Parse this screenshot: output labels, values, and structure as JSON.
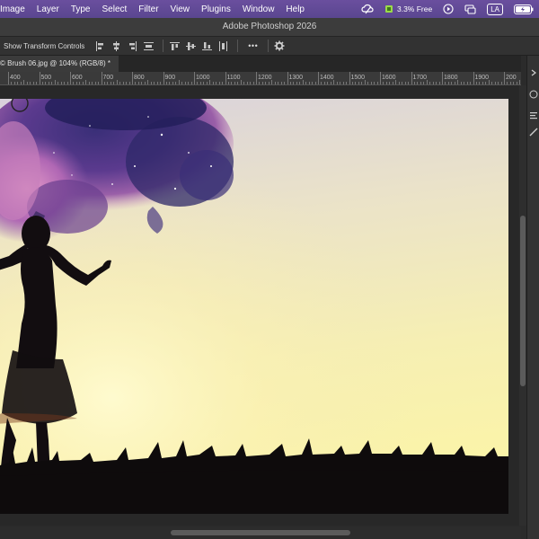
{
  "menubar": {
    "items": [
      "Image",
      "Layer",
      "Type",
      "Select",
      "Filter",
      "View",
      "Plugins",
      "Window",
      "Help"
    ],
    "status": {
      "cpu_label": "3.3% Free",
      "user_badge": "LA"
    }
  },
  "window": {
    "title": "Adobe Photoshop 2026"
  },
  "options_bar": {
    "show_transform_controls": "Show Transform Controls",
    "more_label": "•••"
  },
  "document_tab": {
    "label": "© Brush 06.jpg @ 104% (RGB/8) *"
  },
  "ruler": {
    "labels": [
      "400",
      "500",
      "600",
      "700",
      "800",
      "900",
      "1000",
      "1100",
      "1200",
      "1300",
      "1400",
      "1500",
      "1600",
      "1700",
      "1800",
      "1900",
      "200"
    ]
  },
  "colors": {
    "menubar": "#5a4690",
    "panel": "#323232",
    "workspace": "#282828"
  }
}
